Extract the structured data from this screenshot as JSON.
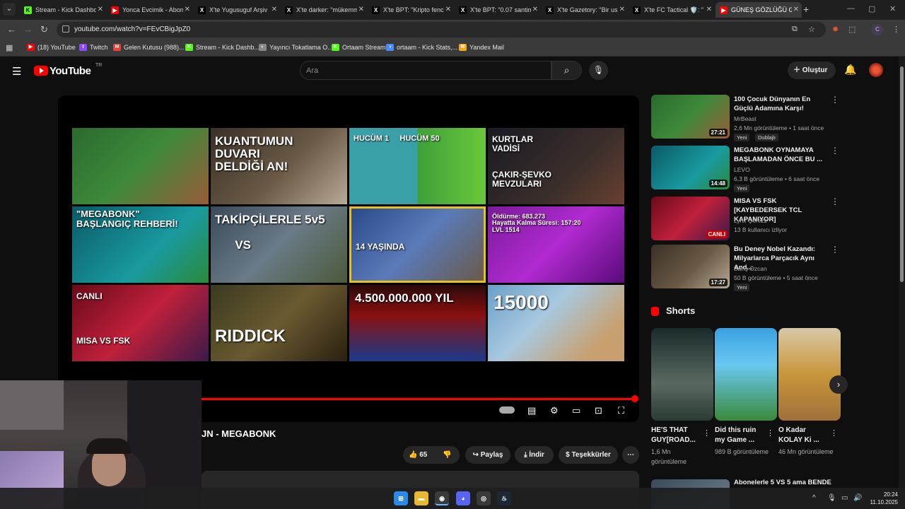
{
  "browser": {
    "tabs": [
      {
        "label": "Stream - Kick Dashbo",
        "icon": "kick-icon",
        "color": "#53fc18"
      },
      {
        "label": "Yonca Evcimik - Abon",
        "icon": "youtube-icon",
        "color": "#ff0000"
      },
      {
        "label": "X'te Yugusuguf Arşiv",
        "icon": "x-icon",
        "color": "#000000"
      },
      {
        "label": "X'te darker: \"mükemm",
        "icon": "x-icon",
        "color": "#000000"
      },
      {
        "label": "X'te BPT: \"Kripto fenc",
        "icon": "x-icon",
        "color": "#000000"
      },
      {
        "label": "X'te BPT: \"0.07 santim",
        "icon": "x-icon",
        "color": "#000000"
      },
      {
        "label": "X'te Gazetory: \"Bir us",
        "icon": "x-icon",
        "color": "#000000"
      },
      {
        "label": "X'te FC Tactical 🛡️: \"",
        "icon": "x-icon",
        "color": "#000000"
      },
      {
        "label": "GÜNEŞ GÖZLÜĞÜ GE",
        "icon": "youtube-icon",
        "color": "#ff0000",
        "active": true
      }
    ],
    "url": "youtube.com/watch?v=FEvCBigJpZ0",
    "profile_letter": "C",
    "bookmarks": [
      {
        "label": "(18) YouTube",
        "color": "#ff0000",
        "glyph": "▶"
      },
      {
        "label": "Twitch",
        "color": "#9146ff",
        "glyph": "t"
      },
      {
        "label": "Gelen Kutusu (988)...",
        "color": "#ea4335",
        "glyph": "M"
      },
      {
        "label": "Stream - Kick Dashb...",
        "color": "#53fc18",
        "glyph": "K"
      },
      {
        "label": "Yayıncı Tokatlama O...",
        "color": "#888888",
        "glyph": "◐"
      },
      {
        "label": "Ortaam Stream",
        "color": "#53fc18",
        "glyph": "K"
      },
      {
        "label": "ortaam - Kick Stats,...",
        "color": "#4a8cff",
        "glyph": "◑"
      },
      {
        "label": "Yandex Mail",
        "color": "#f5a623",
        "glyph": "✉"
      }
    ]
  },
  "youtube": {
    "logo_text": "YouTube",
    "region": "TR",
    "search_placeholder": "Ara",
    "create_label": "Oluştur",
    "video_title": "JN - MEGABONK",
    "actions": {
      "likes": "65",
      "share": "Paylaş",
      "download": "İndir",
      "thanks": "Teşekkürler"
    }
  },
  "player_grid": [
    {
      "text": "",
      "bg": "linear-gradient(135deg,#2a6a2e,#3e8a3a 50%,#9a5a3a)"
    },
    {
      "text": "KUANTUMUN\nDUVARI\nDELDİĞİ AN!",
      "bg": "linear-gradient(135deg,#3a3026,#6a5a46 55%,#b8aa96)"
    },
    {
      "text": "HUCÜM 1     HUCÜM 50",
      "bg": "linear-gradient(90deg,#3aa0a8 0%,#3aa0a8 50%,#3ea03a 50%,#6ac83a 100%)"
    },
    {
      "text": "KURTLAR\nVADİSİ\n\n\nÇAKIR-ŞEVKO\nMEVZULARI",
      "bg": "linear-gradient(135deg,#1a1a24,#3a2e2a 60%,#6a4030)"
    },
    {
      "text": "\"MEGABONK\"\nBAŞLANGIÇ REHBERİ!",
      "bg": "linear-gradient(135deg,#0a5a66,#1a9aa0 60%,#2a8a3a)"
    },
    {
      "text": "TAKİPÇİLERLE 5v5\n\n      VS",
      "bg": "linear-gradient(135deg,#3a4a5a,#6a7a86 50%,#4a5a3a)"
    },
    {
      "text": "\n\n\n14 YAŞINDA",
      "bg": "linear-gradient(135deg,#2a4a8a,#5a7ab8 50%,#6a5a4a)"
    },
    {
      "text": "Öldürme: 683.273\nHayatta Kalma Süresi: 157:20\nLVL 1514",
      "bg": "linear-gradient(135deg,#7a1a9a,#b02ad0 50%,#5a0a7a)"
    },
    {
      "text": "CANLI\n\n\n\n\nMISA VS FSK",
      "bg": "linear-gradient(135deg,#6a0a1a,#c0203a 50%,#3a1a4a)"
    },
    {
      "text": "\n\nRIDDICK",
      "bg": "linear-gradient(135deg,#3a3a20,#6a5a30 50%,#2a2010)"
    },
    {
      "text": "4.500.000.000 YIL",
      "bg": "linear-gradient(180deg,#2a0a0a,#8a1010 40%,#1a3a8a 100%)"
    },
    {
      "text": "15000",
      "bg": "linear-gradient(135deg,#6aa0c8,#a8c8e0 40%,#c8a070 80%)"
    }
  ],
  "recommendations": [
    {
      "title": "100 Çocuk Dünyanın En Güçlü Adamına Karşı!",
      "channel": "MrBeast",
      "meta": "2,6 Mn görüntüleme • 1 saat önce",
      "duration": "27:21",
      "badges": [
        "Yeni",
        "Dublajlı"
      ],
      "bg": "linear-gradient(135deg,#2a6a2e,#3e8a3a 50%,#9a5a3a)"
    },
    {
      "title": "MEGABONK OYNAMAYA BAŞLAMADAN ÖNCE BU ...",
      "channel": "LEVO",
      "meta": "6,3 B görüntüleme • 6 saat önce",
      "duration": "14:48",
      "badges": [
        "Yeni"
      ],
      "bg": "linear-gradient(135deg,#0a5a66,#1a9aa0 60%,#2a8a3a)"
    },
    {
      "title": "MISA VS FSK [KAYBEDERSEK TCL KAPANIYOR]",
      "channel": "Lynx Çerezz",
      "meta": "13 B kullanıcı izliyor",
      "duration": "CANLI",
      "badges": [],
      "bg": "linear-gradient(135deg,#6a0a1a,#c0203a 50%,#3a1a4a)"
    },
    {
      "title": "Bu Deney Nobel Kazandı: Milyarlarca Parçacık Aynı And...",
      "channel": "Barış Özcan",
      "meta": "50 B görüntüleme • 5 saat önce",
      "duration": "17:27",
      "badges": [
        "Yeni"
      ],
      "bg": "linear-gradient(135deg,#3a3026,#6a5a46 55%,#b8aa96)"
    }
  ],
  "shorts": {
    "heading": "Shorts",
    "items": [
      {
        "title": "HE'S THAT GUY[ROAD...",
        "views": "1,6 Mn görüntüleme",
        "bg": "linear-gradient(180deg,#1a2a2a,#5a6a62 60%,#2a3a34)"
      },
      {
        "title": "Did this ruin my Game ...",
        "views": "989 B görüntüleme",
        "bg": "linear-gradient(180deg,#3aa0e0,#6ac8f0 40%,#3a8a3a)"
      },
      {
        "title": "O Kadar KOLAY Ki ...",
        "views": "46 Mn görüntüleme",
        "bg": "linear-gradient(180deg,#d8c8a8,#c8963a 50%,#a0703a)"
      }
    ]
  },
  "next_item_peek": {
    "title": "Abonelerle 5 VS 5 ama BENDE"
  },
  "taskbar": {
    "time": "20:24",
    "date": "11.10.2025"
  }
}
